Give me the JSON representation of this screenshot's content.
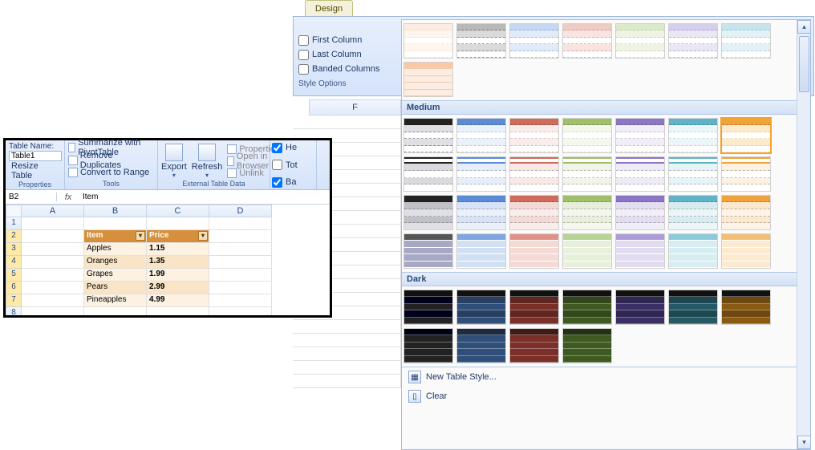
{
  "design_tab": "Design",
  "style_options": {
    "first_col": "First Column",
    "last_col": "Last Column",
    "banded_cols": "Banded Columns",
    "footer": "Style Options"
  },
  "col_f": "F",
  "gallery": {
    "light_colors": [
      "#f7c9a8",
      "#333333",
      "#5b8bd6",
      "#d06a5b",
      "#9fbf6a",
      "#8a76c4",
      "#5fb3c9",
      "#f1a23a"
    ],
    "medium_label": "Medium",
    "medium_rows": [
      [
        "#222",
        "#5b8bd6",
        "#d06a5b",
        "#9fbf6a",
        "#8a76c4",
        "#5fb3c9",
        "#f1a23a"
      ],
      [
        "#222",
        "#5b8bd6",
        "#d06a5b",
        "#9fbf6a",
        "#8a76c4",
        "#5fb3c9",
        "#f1a23a"
      ],
      [
        "#222",
        "#5b8bd6",
        "#d06a5b",
        "#9fbf6a",
        "#8a76c4",
        "#5fb3c9",
        "#f1a23a"
      ],
      [
        "#555",
        "#7fa6e0",
        "#e19288",
        "#b9d394",
        "#ab9cd8",
        "#8ccad9",
        "#f3bf77"
      ]
    ],
    "medium_selected": 6,
    "dark_label": "Dark",
    "dark_colors": [
      "#222",
      "#2f4f7a",
      "#7a2f28",
      "#3f5a21",
      "#3b2f66",
      "#245a66",
      "#8a5a12"
    ],
    "footer_new": "New Table Style...",
    "footer_clear": "Clear"
  },
  "inset": {
    "props": {
      "title": "Table Name:",
      "name": "Table1",
      "resize": "Resize Table",
      "group": "Properties"
    },
    "tools": {
      "pivot": "Summarize with PivotTable",
      "dup": "Remove Duplicates",
      "range": "Convert to Range",
      "group": "Tools"
    },
    "etd": {
      "export": "Export",
      "refresh": "Refresh",
      "props": "Properties",
      "browser": "Open in Browser",
      "unlink": "Unlink",
      "group": "External Table Data"
    },
    "checks": {
      "he": "He",
      "tot": "Tot",
      "ba": "Ba"
    },
    "fbar": {
      "name": "B2",
      "fx": "fx",
      "value": "Item"
    },
    "cols": [
      "A",
      "B",
      "C",
      "D"
    ],
    "rownums": [
      "1",
      "2",
      "3",
      "4",
      "5",
      "6",
      "7",
      "8"
    ],
    "table": {
      "headers": [
        "Item",
        "Price"
      ],
      "rows": [
        [
          "Apples",
          "1.15"
        ],
        [
          "Oranges",
          "1.35"
        ],
        [
          "Grapes",
          "1.99"
        ],
        [
          "Pears",
          "2.99"
        ],
        [
          "Pineapples",
          "4.99"
        ]
      ]
    }
  }
}
